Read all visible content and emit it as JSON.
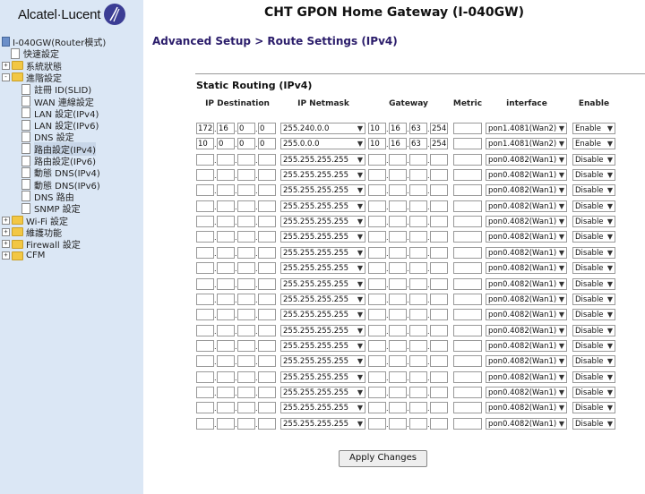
{
  "brand": {
    "logo_text": "Alcatel·Lucent"
  },
  "header": {
    "title": "CHT GPON Home Gateway (I-040GW)"
  },
  "breadcrumb": "Advanced Setup > Route Settings (IPv4)",
  "section_title": "Static Routing (IPv4)",
  "sidebar": {
    "root": "I-040GW(Router模式)",
    "items": [
      {
        "label": "快速設定",
        "type": "doc",
        "level": 1
      },
      {
        "label": "系統狀態",
        "type": "folder",
        "level": 0,
        "expander": "+"
      },
      {
        "label": "進階設定",
        "type": "folder",
        "level": 0,
        "expander": "-"
      },
      {
        "label": "註冊 ID(SLID)",
        "type": "doc",
        "level": 2
      },
      {
        "label": "WAN 連線設定",
        "type": "doc",
        "level": 2
      },
      {
        "label": "LAN 設定(IPv4)",
        "type": "doc",
        "level": 2
      },
      {
        "label": "LAN 設定(IPv6)",
        "type": "doc",
        "level": 2
      },
      {
        "label": "DNS 設定",
        "type": "doc",
        "level": 2
      },
      {
        "label": "路由設定(IPv4)",
        "type": "doc",
        "level": 2,
        "selected": true
      },
      {
        "label": "路由設定(IPv6)",
        "type": "doc",
        "level": 2
      },
      {
        "label": "動態 DNS(IPv4)",
        "type": "doc",
        "level": 2
      },
      {
        "label": "動態 DNS(IPv6)",
        "type": "doc",
        "level": 2
      },
      {
        "label": "DNS 路由",
        "type": "doc",
        "level": 2
      },
      {
        "label": "SNMP 設定",
        "type": "doc",
        "level": 2
      },
      {
        "label": "Wi-Fi 設定",
        "type": "folder",
        "level": 0,
        "expander": "+"
      },
      {
        "label": "維護功能",
        "type": "folder",
        "level": 0,
        "expander": "+"
      },
      {
        "label": "Firewall 設定",
        "type": "folder",
        "level": 0,
        "expander": "+"
      },
      {
        "label": "CFM",
        "type": "folder",
        "level": 0,
        "expander": "+"
      }
    ]
  },
  "table": {
    "headers": [
      "IP Destination",
      "IP Netmask",
      "Gateway",
      "Metric",
      "interface",
      "Enable"
    ],
    "rows": [
      {
        "dest": [
          "172",
          "16",
          "0",
          "0"
        ],
        "mask": "255.240.0.0",
        "gw": [
          "10",
          "16",
          "63",
          "254"
        ],
        "metric": "",
        "iface": "pon1.4081(Wan2)",
        "enable": "Enable"
      },
      {
        "dest": [
          "10",
          "0",
          "0",
          "0"
        ],
        "mask": "255.0.0.0",
        "gw": [
          "10",
          "16",
          "63",
          "254"
        ],
        "metric": "",
        "iface": "pon1.4081(Wan2)",
        "enable": "Enable"
      },
      {
        "dest": [
          "",
          "",
          "",
          ""
        ],
        "mask": "255.255.255.255",
        "gw": [
          "",
          "",
          "",
          ""
        ],
        "metric": "",
        "iface": "pon0.4082(Wan1)",
        "enable": "Disable"
      },
      {
        "dest": [
          "",
          "",
          "",
          ""
        ],
        "mask": "255.255.255.255",
        "gw": [
          "",
          "",
          "",
          ""
        ],
        "metric": "",
        "iface": "pon0.4082(Wan1)",
        "enable": "Disable"
      },
      {
        "dest": [
          "",
          "",
          "",
          ""
        ],
        "mask": "255.255.255.255",
        "gw": [
          "",
          "",
          "",
          ""
        ],
        "metric": "",
        "iface": "pon0.4082(Wan1)",
        "enable": "Disable"
      },
      {
        "dest": [
          "",
          "",
          "",
          ""
        ],
        "mask": "255.255.255.255",
        "gw": [
          "",
          "",
          "",
          ""
        ],
        "metric": "",
        "iface": "pon0.4082(Wan1)",
        "enable": "Disable"
      },
      {
        "dest": [
          "",
          "",
          "",
          ""
        ],
        "mask": "255.255.255.255",
        "gw": [
          "",
          "",
          "",
          ""
        ],
        "metric": "",
        "iface": "pon0.4082(Wan1)",
        "enable": "Disable"
      },
      {
        "dest": [
          "",
          "",
          "",
          ""
        ],
        "mask": "255.255.255.255",
        "gw": [
          "",
          "",
          "",
          ""
        ],
        "metric": "",
        "iface": "pon0.4082(Wan1)",
        "enable": "Disable"
      },
      {
        "dest": [
          "",
          "",
          "",
          ""
        ],
        "mask": "255.255.255.255",
        "gw": [
          "",
          "",
          "",
          ""
        ],
        "metric": "",
        "iface": "pon0.4082(Wan1)",
        "enable": "Disable"
      },
      {
        "dest": [
          "",
          "",
          "",
          ""
        ],
        "mask": "255.255.255.255",
        "gw": [
          "",
          "",
          "",
          ""
        ],
        "metric": "",
        "iface": "pon0.4082(Wan1)",
        "enable": "Disable"
      },
      {
        "dest": [
          "",
          "",
          "",
          ""
        ],
        "mask": "255.255.255.255",
        "gw": [
          "",
          "",
          "",
          ""
        ],
        "metric": "",
        "iface": "pon0.4082(Wan1)",
        "enable": "Disable"
      },
      {
        "dest": [
          "",
          "",
          "",
          ""
        ],
        "mask": "255.255.255.255",
        "gw": [
          "",
          "",
          "",
          ""
        ],
        "metric": "",
        "iface": "pon0.4082(Wan1)",
        "enable": "Disable"
      },
      {
        "dest": [
          "",
          "",
          "",
          ""
        ],
        "mask": "255.255.255.255",
        "gw": [
          "",
          "",
          "",
          ""
        ],
        "metric": "",
        "iface": "pon0.4082(Wan1)",
        "enable": "Disable"
      },
      {
        "dest": [
          "",
          "",
          "",
          ""
        ],
        "mask": "255.255.255.255",
        "gw": [
          "",
          "",
          "",
          ""
        ],
        "metric": "",
        "iface": "pon0.4082(Wan1)",
        "enable": "Disable"
      },
      {
        "dest": [
          "",
          "",
          "",
          ""
        ],
        "mask": "255.255.255.255",
        "gw": [
          "",
          "",
          "",
          ""
        ],
        "metric": "",
        "iface": "pon0.4082(Wan1)",
        "enable": "Disable"
      },
      {
        "dest": [
          "",
          "",
          "",
          ""
        ],
        "mask": "255.255.255.255",
        "gw": [
          "",
          "",
          "",
          ""
        ],
        "metric": "",
        "iface": "pon0.4082(Wan1)",
        "enable": "Disable"
      },
      {
        "dest": [
          "",
          "",
          "",
          ""
        ],
        "mask": "255.255.255.255",
        "gw": [
          "",
          "",
          "",
          ""
        ],
        "metric": "",
        "iface": "pon0.4082(Wan1)",
        "enable": "Disable"
      },
      {
        "dest": [
          "",
          "",
          "",
          ""
        ],
        "mask": "255.255.255.255",
        "gw": [
          "",
          "",
          "",
          ""
        ],
        "metric": "",
        "iface": "pon0.4082(Wan1)",
        "enable": "Disable"
      },
      {
        "dest": [
          "",
          "",
          "",
          ""
        ],
        "mask": "255.255.255.255",
        "gw": [
          "",
          "",
          "",
          ""
        ],
        "metric": "",
        "iface": "pon0.4082(Wan1)",
        "enable": "Disable"
      },
      {
        "dest": [
          "",
          "",
          "",
          ""
        ],
        "mask": "255.255.255.255",
        "gw": [
          "",
          "",
          "",
          ""
        ],
        "metric": "",
        "iface": "pon0.4082(Wan1)",
        "enable": "Disable"
      }
    ]
  },
  "apply_label": "Apply Changes",
  "colors": {
    "sidebar_bg": "#dbe7f5",
    "breadcrumb": "#2b1d6b",
    "logo_mark": "#3b3d94"
  }
}
